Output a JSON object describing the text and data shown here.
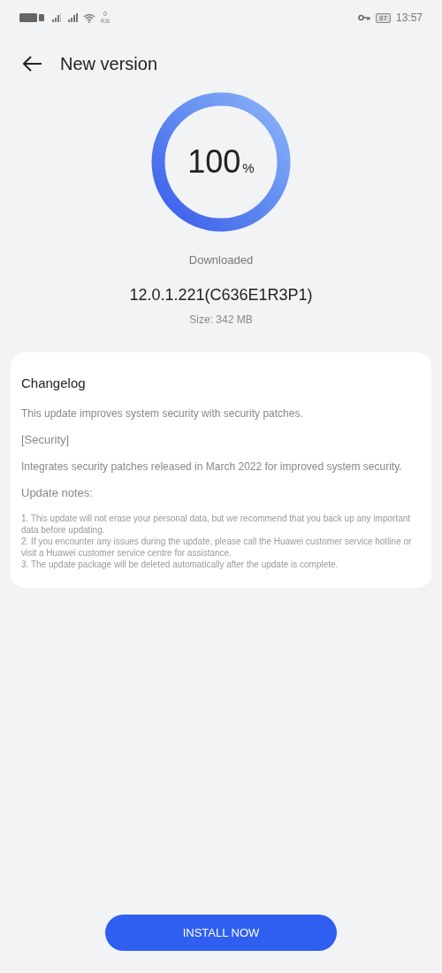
{
  "status_bar": {
    "speed_value": "0",
    "speed_unit": "K/s",
    "battery": "87",
    "time": "13:57"
  },
  "header": {
    "title": "New version"
  },
  "progress": {
    "level": 1.0,
    "percent": "100",
    "unit": "%",
    "status": "Downloaded"
  },
  "version": "12.0.1.221(C636E1R3P1)",
  "size": "Size: 342 MB",
  "changelog": {
    "title": "Changelog",
    "summary": "This update improves system security with security patches.",
    "section": "[Security]",
    "section_text": "Integrates security patches released in March 2022 for improved system security.",
    "notes_title": "Update notes:",
    "notes": [
      "1. This update will not erase your personal data, but we recommend that you back up any important data before updating.",
      "2. If you encounter any issues during the update, please call the Huawei customer service hotline or visit a Huawei customer service centre for assistance.",
      "3. The update package will be deleted automatically after the update is complete."
    ]
  },
  "button": "INSTALL NOW"
}
